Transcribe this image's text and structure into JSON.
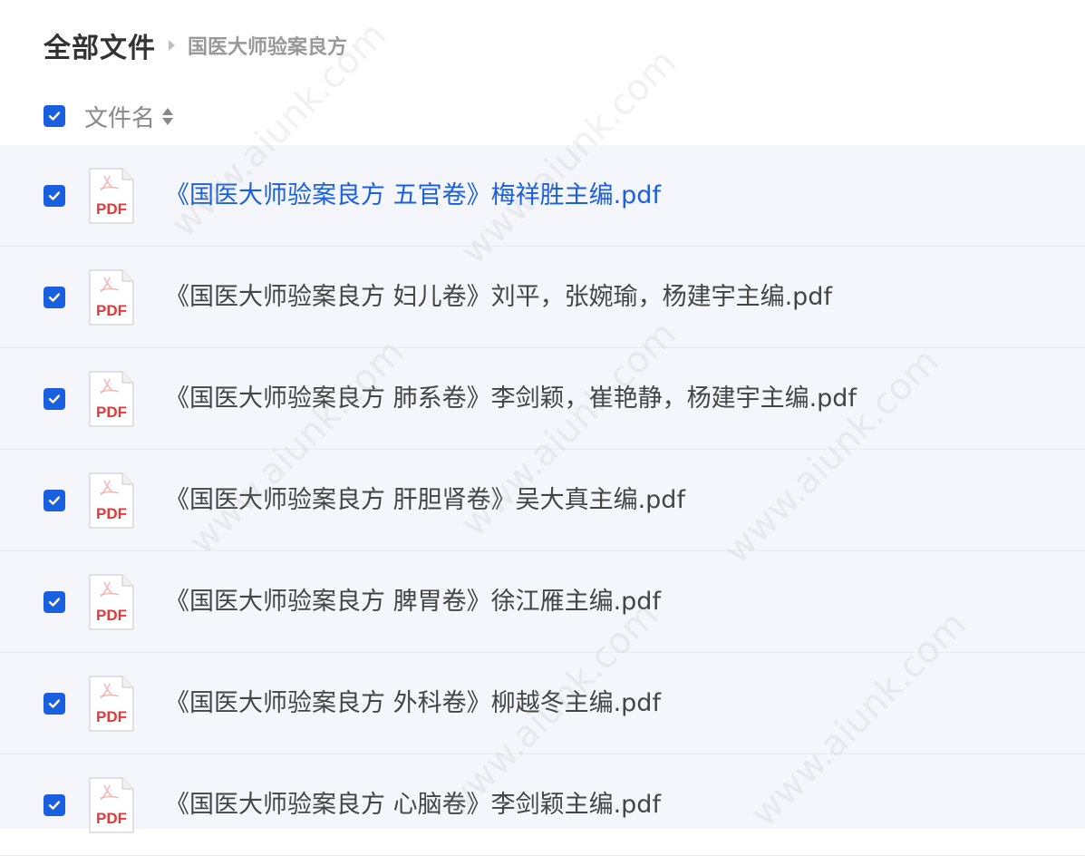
{
  "breadcrumb": {
    "root": "全部文件",
    "current": "国医大师验案良方"
  },
  "list_header": {
    "column_label": "文件名"
  },
  "colors": {
    "accent": "#1a5fe0",
    "pdf_red": "#e03a3a",
    "list_bg": "#f4f6fc"
  },
  "icons": {
    "pdf": "pdf-file-icon",
    "check": "checkmark-icon",
    "sort": "sort-icon"
  },
  "pdf_badge": "PDF",
  "watermark_text": "www.aiunk.com",
  "files": [
    {
      "name": "《国医大师验案良方 五官卷》梅祥胜主编.pdf",
      "checked": true,
      "active": true
    },
    {
      "name": "《国医大师验案良方 妇儿卷》刘平，张婉瑜，杨建宇主编.pdf",
      "checked": true,
      "active": false
    },
    {
      "name": "《国医大师验案良方 肺系卷》李剑颖，崔艳静，杨建宇主编.pdf",
      "checked": true,
      "active": false
    },
    {
      "name": "《国医大师验案良方 肝胆肾卷》吴大真主编.pdf",
      "checked": true,
      "active": false
    },
    {
      "name": "《国医大师验案良方 脾胃卷》徐江雁主编.pdf",
      "checked": true,
      "active": false
    },
    {
      "name": "《国医大师验案良方 外科卷》柳越冬主编.pdf",
      "checked": true,
      "active": false
    },
    {
      "name": "《国医大师验案良方 心脑卷》李剑颖主编.pdf",
      "checked": true,
      "active": false
    }
  ]
}
